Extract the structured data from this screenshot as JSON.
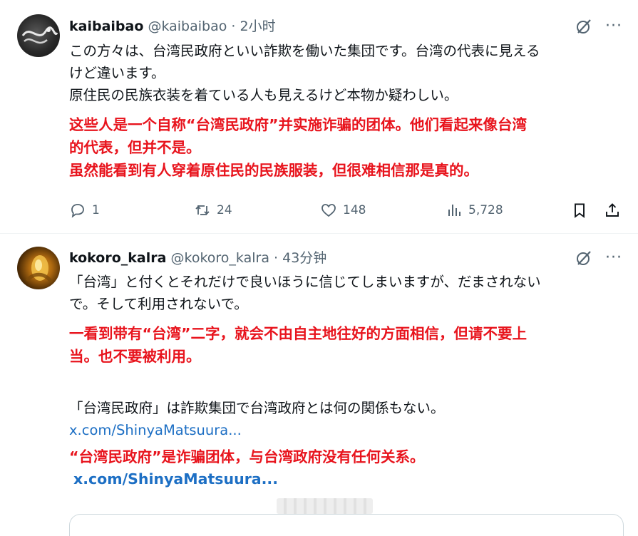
{
  "tweets": [
    {
      "name": "kaibaibao",
      "handle": "@kaibaibao",
      "dot": "·",
      "time": "2小时",
      "jp_lines": [
        "この方々は、台湾民政府といい詐欺を働いた集団です。台湾の代表に見える",
        "けど違います。",
        "原住民の民族衣装を着ている人も見えるけど本物か疑わしい。"
      ],
      "cn_lines": [
        "这些人是一个自称“台湾民政府”并实施诈骗的团体。他们看起来像台湾",
        "的代表，但并不是。",
        "虽然能看到有人穿着原住民的民族服装，但很难相信那是真的。"
      ],
      "stats": {
        "replies": "1",
        "retweets": "24",
        "likes": "148",
        "views": "5,728"
      }
    },
    {
      "name": "kokoro_kalra",
      "handle": "@kokoro_kalra",
      "dot": "·",
      "time": "43分钟",
      "jp_lines": [
        "「台湾」と付くとそれだけで良いほうに信じてしまいますが、だまされない",
        "で。そして利用されないで。"
      ],
      "cn_lines": [
        "一看到带有“台湾”二字，就会不由自主地往好的方面相信，但请不要上",
        "当。也不要被利用。"
      ],
      "jp_line_2": "「台湾民政府」は詐欺集団で台湾政府とは何の関係もない。",
      "link_1": "x.com/ShinyaMatsuura...",
      "cn_line_2": "“台湾民政府”是诈骗团体，与台湾政府没有任何关系。",
      "link_2": "x.com/ShinyaMatsuura..."
    }
  ],
  "more_glyph": "···",
  "icons": {
    "grok": "grok-icon",
    "more": "more-icon",
    "reply": "reply-icon",
    "retweet": "retweet-icon",
    "like": "heart-icon",
    "views": "views-icon",
    "bookmark": "bookmark-icon",
    "share": "share-icon"
  },
  "colors": {
    "translation_red": "#e8141d",
    "link_blue": "#1d6fc4",
    "secondary_gray": "#536471"
  }
}
